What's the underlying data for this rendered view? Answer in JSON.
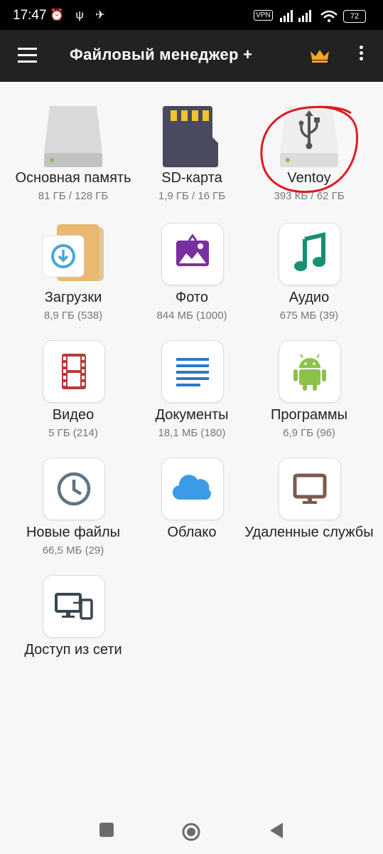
{
  "status": {
    "time": "17:47",
    "vpn": "VPN",
    "battery": "72"
  },
  "appbar": {
    "title": "Файловый менеджер +"
  },
  "storage": [
    {
      "label": "Основная память",
      "sub": "81 ГБ / 128 ГБ"
    },
    {
      "label": "SD-карта",
      "sub": "1,9 ГБ / 16 ГБ"
    },
    {
      "label": "Ventoy",
      "sub": "393 КБ / 62 ГБ"
    }
  ],
  "categories": [
    {
      "label": "Загрузки",
      "sub": "8,9 ГБ (538)"
    },
    {
      "label": "Фото",
      "sub": "844 МБ (1000)"
    },
    {
      "label": "Аудио",
      "sub": "675 МБ (39)"
    },
    {
      "label": "Видео",
      "sub": "5 ГБ (214)"
    },
    {
      "label": "Документы",
      "sub": "18,1 МБ (180)"
    },
    {
      "label": "Программы",
      "sub": "6,9 ГБ (96)"
    },
    {
      "label": "Новые файлы",
      "sub": "66,5 МБ (29)"
    },
    {
      "label": "Облако",
      "sub": ""
    },
    {
      "label": "Удаленные службы",
      "sub": ""
    },
    {
      "label": "Доступ из сети",
      "sub": ""
    }
  ],
  "colors": {
    "appbar": "#222222",
    "crown": "#f5a623",
    "annotation": "#e0191f"
  }
}
